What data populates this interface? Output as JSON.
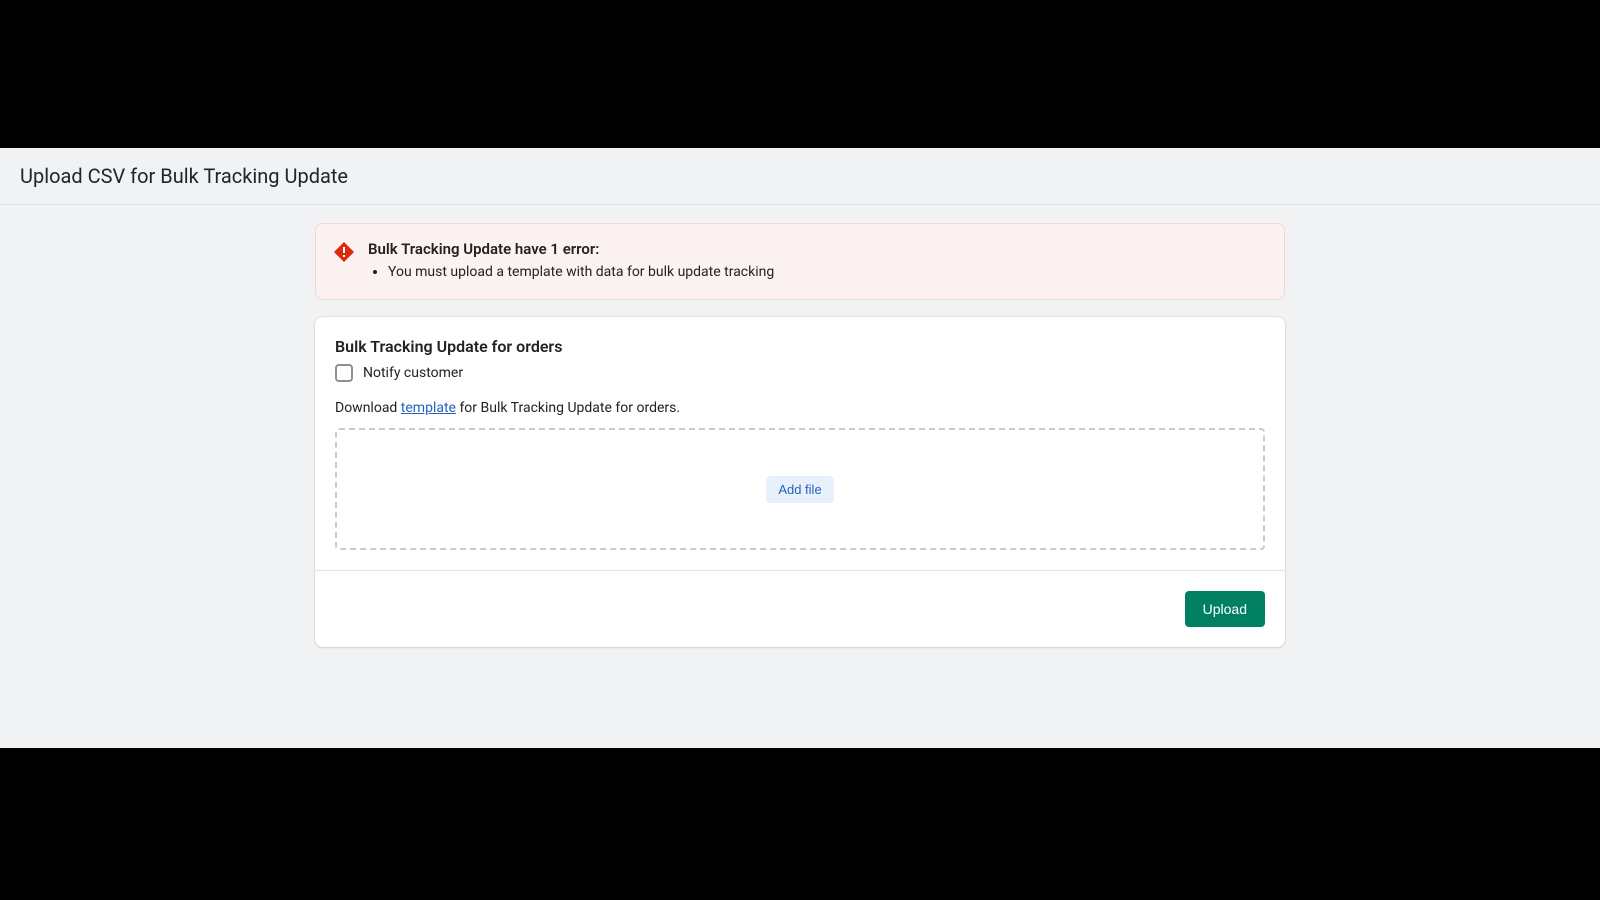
{
  "page": {
    "title": "Upload CSV for Bulk Tracking Update"
  },
  "error": {
    "title": "Bulk Tracking Update have 1 error:",
    "messages": [
      "You must upload a template with data for bulk update tracking"
    ]
  },
  "form": {
    "title": "Bulk Tracking Update for orders",
    "notify_label": "Notify customer",
    "download_prefix": "Download ",
    "download_link_text": "template",
    "download_suffix": " for Bulk Tracking Update for orders.",
    "add_file_label": "Add file",
    "upload_button_label": "Upload"
  },
  "colors": {
    "error_bg": "#fdf2f2",
    "error_border": "#f5d6d6",
    "error_icon": "#d82c0d",
    "primary_button": "#008060",
    "link": "#2463bc"
  }
}
